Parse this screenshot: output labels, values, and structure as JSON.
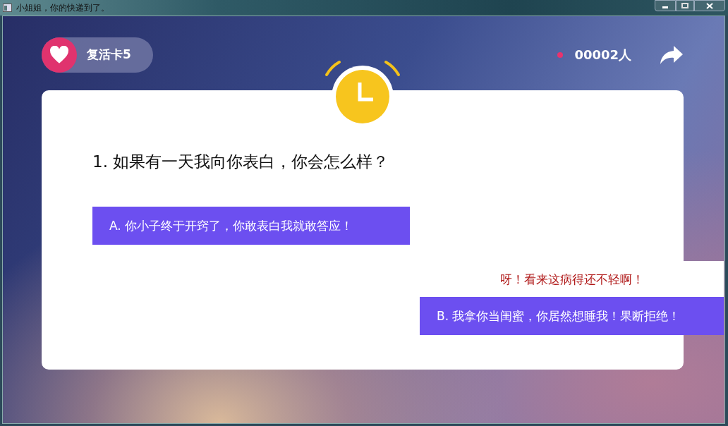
{
  "window": {
    "title": "小姐姐，你的快递到了。"
  },
  "lives": {
    "label": "复活卡5"
  },
  "online": {
    "count": "00002人"
  },
  "question": {
    "text": "1. 如果有一天我向你表白，你会怎么样？"
  },
  "options": [
    {
      "label": "A. 你小子终于开窍了，你敢表白我就敢答应！"
    },
    {
      "label": "B. 我拿你当闺蜜，你居然想睡我！果断拒绝！",
      "feedback": "呀！看来这病得还不轻啊！"
    }
  ]
}
